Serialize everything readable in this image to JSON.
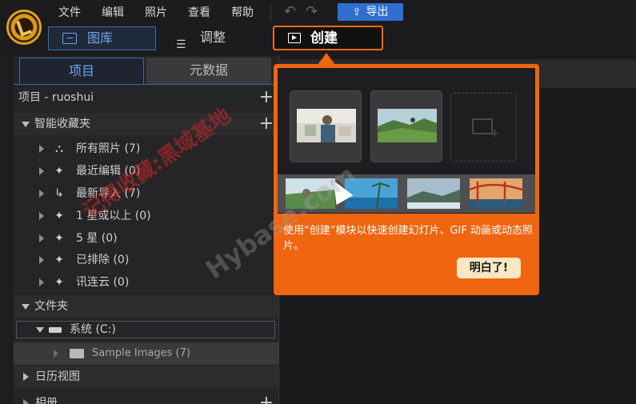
{
  "menu": [
    "文件",
    "编辑",
    "照片",
    "查看",
    "帮助"
  ],
  "toolbar": {
    "export_label": "导出",
    "export_icon": "upload-icon",
    "undo_icon": "undo-icon",
    "redo_icon": "redo-icon"
  },
  "modes": {
    "library": "图库",
    "adjust": "调整",
    "create": "创建"
  },
  "panel_tabs": {
    "project": "项目",
    "metadata": "元数据"
  },
  "project_header": "项目 - ruoshui",
  "smart_collections": {
    "title": "智能收藏夹",
    "items": [
      {
        "label": "所有照片 (7)",
        "icon": "hierarchy-icon"
      },
      {
        "label": "最近编辑 (0)",
        "icon": "magic-wand-icon"
      },
      {
        "label": "最新导入 (7)",
        "icon": "import-arrow-icon"
      },
      {
        "label": "1 星或以上 (0)",
        "icon": "magic-wand-icon"
      },
      {
        "label": "5 星 (0)",
        "icon": "magic-wand-icon"
      },
      {
        "label": "已排除 (0)",
        "icon": "magic-wand-icon"
      },
      {
        "label": "讯连云 (0)",
        "icon": "magic-wand-icon"
      }
    ]
  },
  "folders": {
    "title": "文件夹",
    "drive": "系统 (C:)",
    "sample": "Sample Images (7)"
  },
  "calendar_title": "日历视图",
  "albums_title": "相册",
  "callout": {
    "text": "使用“创建”模块以快速创建幻灯片、GIF 动画或动态照片。",
    "button": "明白了!"
  },
  "watermark": {
    "line1": "记得收藏:黑域基地",
    "line2": "Hybase.com"
  },
  "colors": {
    "accent_orange": "#f0650f",
    "accent_blue": "#3e6aa8",
    "export_blue": "#2f6fd0"
  }
}
